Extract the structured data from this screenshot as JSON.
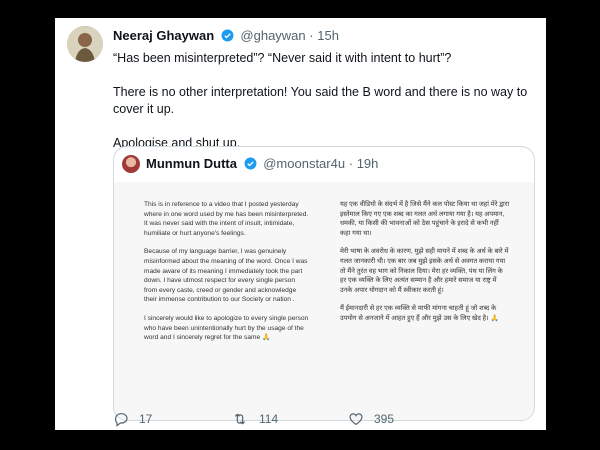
{
  "tweet": {
    "author_name": "Neeraj Ghaywan",
    "handle": "@ghaywan",
    "separator": "·",
    "time": "15h",
    "paragraphs": [
      "“Has been misinterpreted”? “Never said it with intent to hurt”?",
      "There is no other interpretation! You said the B word and there is no way to cover it up.",
      "Apologise and shut up."
    ]
  },
  "quote": {
    "author_name": "Munmun Dutta",
    "handle": "@moonstar4u",
    "separator": "·",
    "time": "19h",
    "statement_en": [
      "This is in reference to a video that I posted yesterday where in one word used by me has been misinterpreted.    It was never said with the intent of insult, intimidate, humiliate or hurt anyone's feelings.",
      "Because of my language barrier,  I was genuinely misinformed about the meaning of the word. Once I was made aware of its  meaning I immediately took the part down. I have utmost respect for every single person from every caste, creed or gender and acknowledge their immense contribution to our Society or nation .",
      "I sincerely would like to apologize to every single person  who have been unintentionally hurt by the usage of the word and I sincerely regret for the same 🙏"
    ],
    "statement_hi": [
      "यह एक वीडियो के संदर्भ में है जिसे मैंने कल पोस्ट किया था जहां मेरे द्वारा इस्तेमाल किए गए एक शब्द का गलत अर्थ लगाया गया है। यह अपमान, धमकी, या किसी की भावनाओं को ठेस पहुंचाने के इरादे से कभी नहीं कहा गया था।",
      "मेरी भाषा के अवरोध के कारण, मुझे सही मायने में शब्द के अर्थ के बारे में गलत जानकारी थी। एक बार जब मुझे इसके अर्थ से अवगत कराया गया तो मैंने तुरंत वह भाग को निकाल दिया। मेरा हर व्यक्ति, पंथ या लिंग के हर एक व्यक्ति के लिए अत्यंत सम्मान है और हमारे समाज या राष्ट्र में उनके अपार योगदान को मैं स्वीकार करती हूं।",
      "मैं ईमानदारी से हर एक व्यक्ति से माफी मांगना चाहती हूं जो शब्द के उपयोग से अनजाने में आहत हुए हैं और मुझे उस के लिए खेद है। 🙏"
    ]
  },
  "actions": {
    "replies": "17",
    "retweets": "114",
    "likes": "395"
  },
  "colors": {
    "verified": "#1d9bf0",
    "muted": "#536471",
    "text": "#0f1419"
  },
  "icons": [
    "verified-badge-icon",
    "reply-icon",
    "retweet-icon",
    "like-icon"
  ]
}
